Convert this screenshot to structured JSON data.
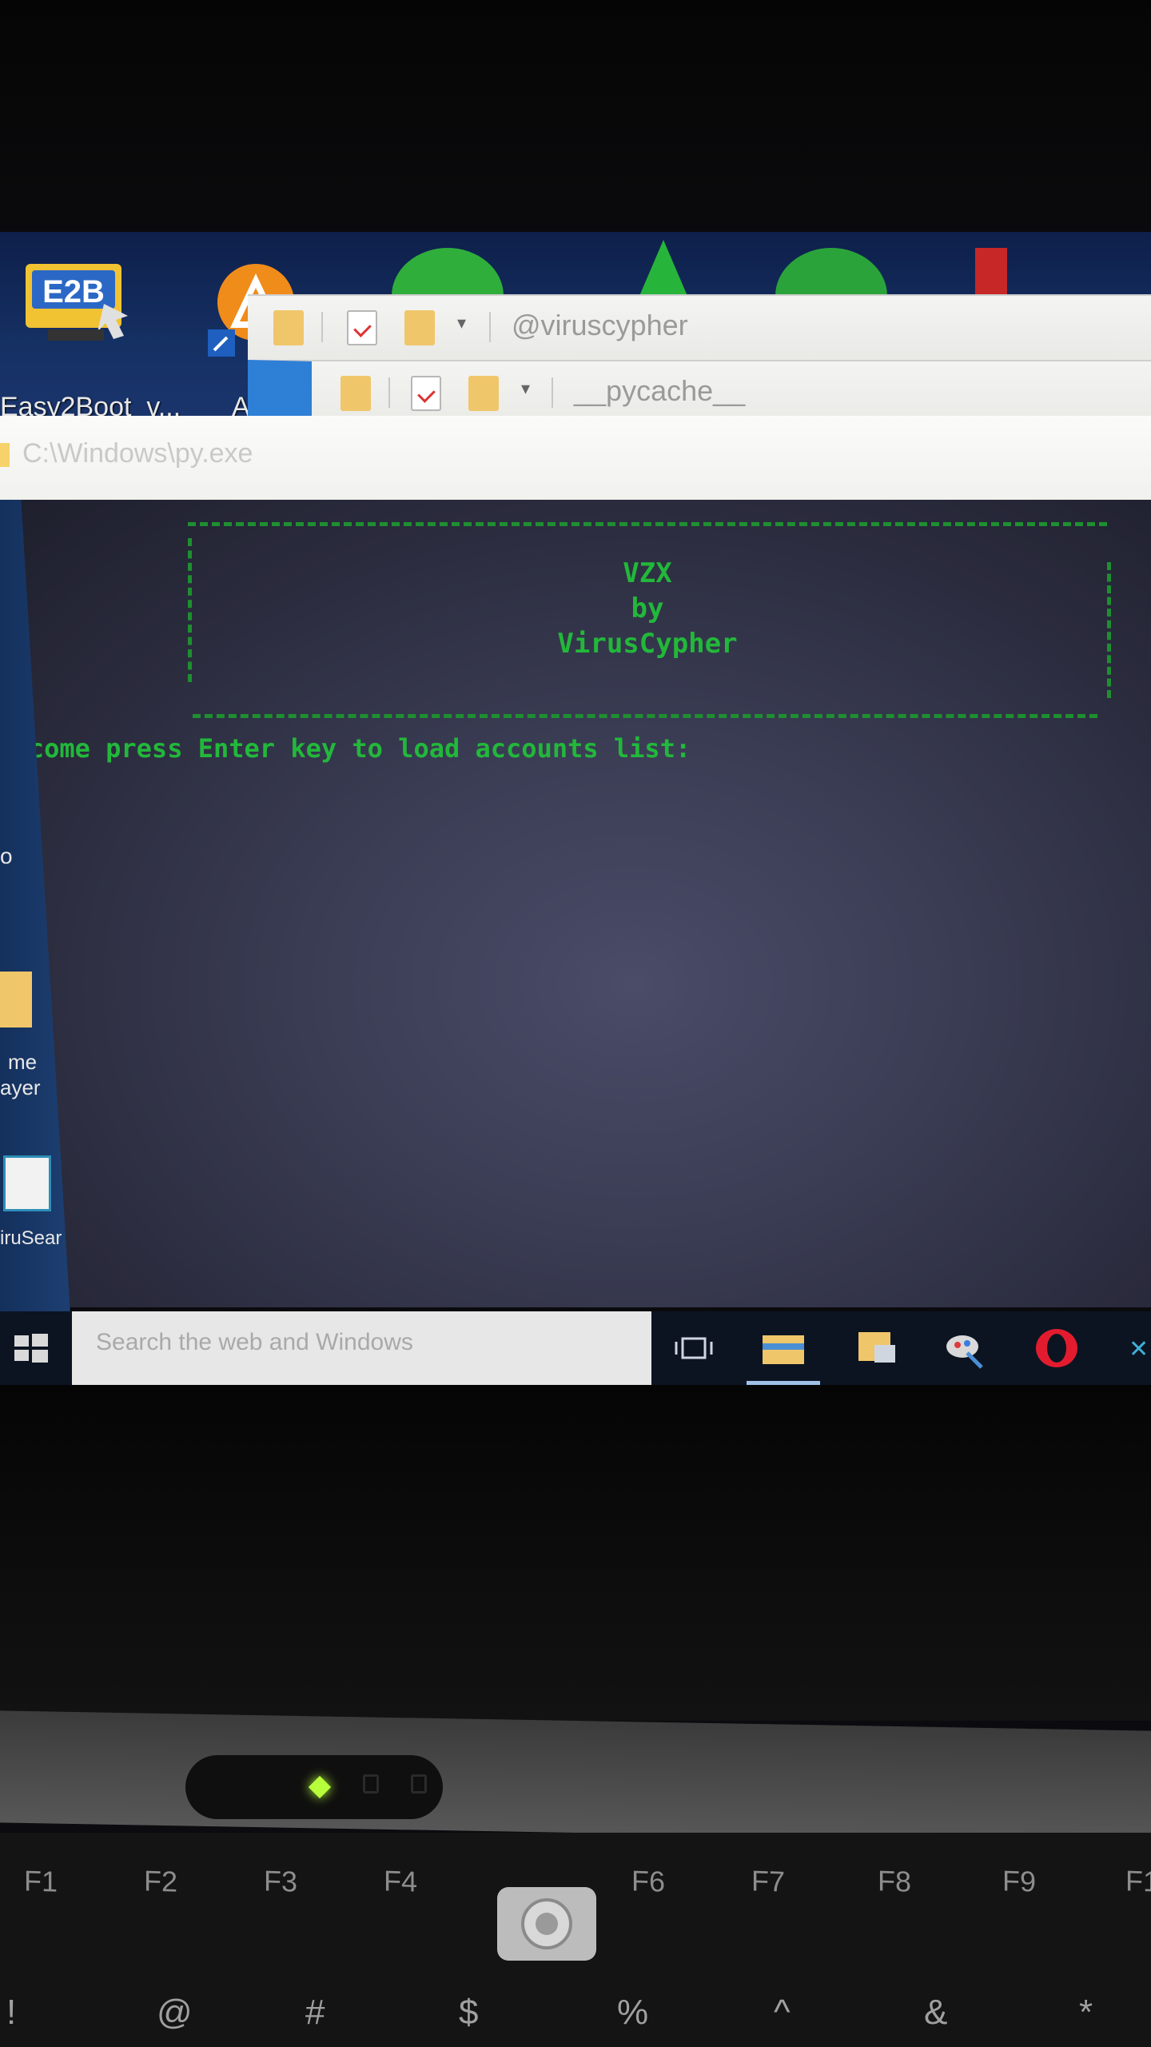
{
  "desktop": {
    "icons": [
      {
        "label": "Easy2Boot_v...",
        "badge": "E2B"
      },
      {
        "label": "A"
      }
    ],
    "left_labels": [
      "me",
      "ayer",
      "iruSear"
    ],
    "left_glyphs": [
      "o"
    ]
  },
  "explorer_windows": [
    {
      "title": "@viruscypher"
    },
    {
      "title": "__pycache__"
    }
  ],
  "console": {
    "title": "C:\\Windows\\py.exe",
    "banner": [
      "VZX",
      "by",
      "VirusCypher"
    ],
    "prompt": "welcome press Enter key to load accounts list:"
  },
  "taskbar": {
    "search_placeholder": "Search the web and Windows",
    "items": [
      "task-view-icon",
      "file-explorer-icon",
      "explorer-window-icon",
      "paint-app-icon",
      "opera-browser-icon"
    ],
    "accent": "#9fc1e8"
  },
  "keyboard": {
    "function_keys": [
      "F1",
      "F2",
      "F3",
      "F4",
      "F6",
      "F7",
      "F8",
      "F9",
      "F1"
    ],
    "number_row": [
      "!",
      "@",
      "#",
      "$",
      "%",
      "^",
      "&",
      "*"
    ],
    "led_color": "#b6ff3a"
  },
  "colors": {
    "console_text": "#22b83a",
    "console_bg": "#3b3d55",
    "desktop_bg": "#153063"
  }
}
